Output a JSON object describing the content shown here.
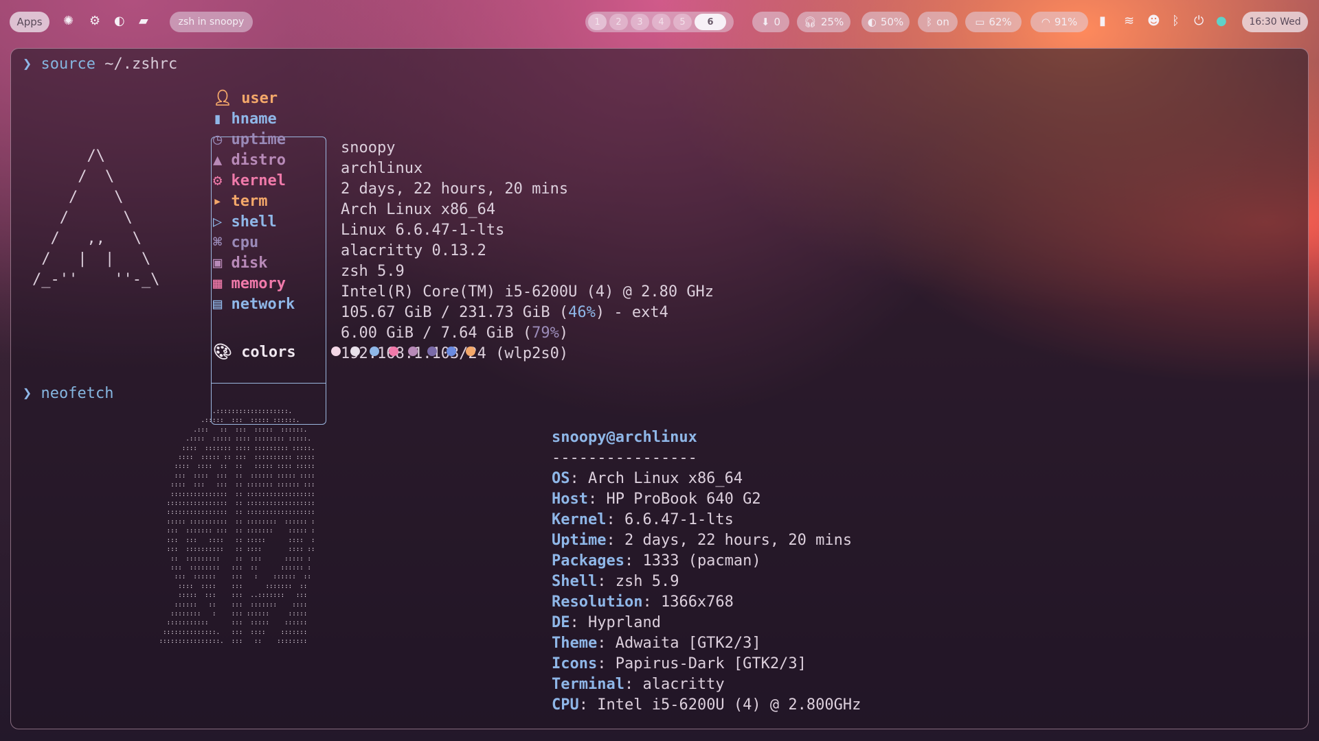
{
  "topbar": {
    "apps_label": "Apps",
    "window_title": "zsh in snoopy",
    "workspaces": [
      "1",
      "2",
      "3",
      "4",
      "5",
      "6"
    ],
    "active_workspace": "6",
    "updates": "0",
    "volume": "25%",
    "brightness": "50%",
    "bluetooth": "on",
    "battery": "62%",
    "wifi": "91%",
    "clock": "16:30 Wed"
  },
  "terminal": {
    "prompt_symbol": "❯",
    "cmd1_word": "source",
    "cmd1_arg": "~/.zshrc",
    "cmd2_word": "neofetch",
    "arch_ascii": "      /\\\n     /  \\\n    /    \\\n   /      \\\n  /   ,,   \\\n /   |  |   \\\n/_-''    ''-_\\",
    "fetch": {
      "keys": [
        "user",
        "hname",
        "uptime",
        "distro",
        "kernel",
        "term",
        "shell",
        "cpu",
        "disk",
        "memory",
        "network"
      ],
      "key_colors": [
        "#f4a86a",
        "#8fb7e8",
        "#9a8ab8",
        "#b88ab8",
        "#f07aaa",
        "#f4a86a",
        "#8fb7e8",
        "#9a8ab8",
        "#b88ab8",
        "#f07aaa",
        "#8fb7e8"
      ],
      "values": {
        "user": "snoopy",
        "hname": "archlinux",
        "uptime": "2 days, 22 hours, 20 mins",
        "distro": "Arch Linux x86_64",
        "kernel": "Linux 6.6.47-1-lts",
        "term": "alacritty 0.13.2",
        "shell": "zsh 5.9",
        "cpu": "Intel(R) Core(TM) i5-6200U (4) @ 2.80 GHz",
        "disk_pre": "105.67 GiB / 231.73 GiB (",
        "disk_pct": "46%",
        "disk_post": ") - ext4",
        "mem_pre": "6.00 GiB / 7.64 GiB (",
        "mem_pct": "79%",
        "mem_post": ")",
        "network": "192.168.1.103/24 (wlp2s0)"
      },
      "colors_label": "colors",
      "palette": [
        "#f4d7e6",
        "#e8e0ea",
        "#8fb7e8",
        "#f07aaa",
        "#b88ab8",
        "#7a6aa8",
        "#6a8ae0",
        "#f4a86a"
      ]
    },
    "neofetch": {
      "title": "snoopy@archlinux",
      "dashes": "----------------",
      "rows": [
        {
          "key": "OS",
          "value": "Arch Linux x86_64"
        },
        {
          "key": "Host",
          "value": "HP ProBook 640 G2"
        },
        {
          "key": "Kernel",
          "value": "6.6.47-1-lts"
        },
        {
          "key": "Uptime",
          "value": "2 days, 22 hours, 20 mins"
        },
        {
          "key": "Packages",
          "value": "1333 (pacman)"
        },
        {
          "key": "Shell",
          "value": "zsh 5.9"
        },
        {
          "key": "Resolution",
          "value": "1366x768"
        },
        {
          "key": "DE",
          "value": "Hyprland"
        },
        {
          "key": "Theme",
          "value": "Adwaita [GTK2/3]"
        },
        {
          "key": "Icons",
          "value": "Papirus-Dark [GTK2/3]"
        },
        {
          "key": "Terminal",
          "value": "alacritty"
        },
        {
          "key": "CPU",
          "value": "Intel i5-6200U (4) @ 2.800GHz"
        }
      ]
    },
    "ascii_portrait": "                 .:::::::::::::::::::.\n              .:::::  :::  ::::: ::::::.\n            .:::   ::  :::  :::::  ::::::.\n          .::::  ::::: :::: :::::::: :::::.\n         ::::  ::::::: :::: ::::::::: :::::.\n        ::::  ::::: :: :::  :::::::::: :::::\n       ::::  ::::  ::  ::   ::::: :::: :::::\n       :::  ::::  :::  ::  :::::: ::::: ::::\n      ::::  :::   :::  :: ::::::: :::::: :::\n      :::::::::::::::  :: ::::::::::::::::::\n     ::::::::::::::::  :: ::::::::::::::::::\n     ::::::::::::::::  :: ::::::::::::::::::\n     ::::: ::::::::::  :: ::::::::  :::::: :\n     :::  ::::::: :::  :: :::::::    ::::: :\n     :::  :::   ::::   :: :::::      ::::  :\n     :::  ::::::::::   :: ::::       :::: ::\n      ::  :::::::::    ::  :::      ::::: :\n      :::  ::::::::   :::  ::      :::::: :\n       :::  ::::::    :::   :    ::::::  ::\n        ::::  ::::    :::      :::::::  ::\n        :::::  :::    :::  ..:::::::   :::\n       ::::::   ::    :::  :::::::    ::::\n      ::::::::   :    ::: ::::::     :::::\n     :::::::::::      :::  :::::    ::::::\n    ::::::::::::::.   :::  ::::    :::::::\n   ::::::::::::::::.  :::   ::    ::::::::"
  }
}
